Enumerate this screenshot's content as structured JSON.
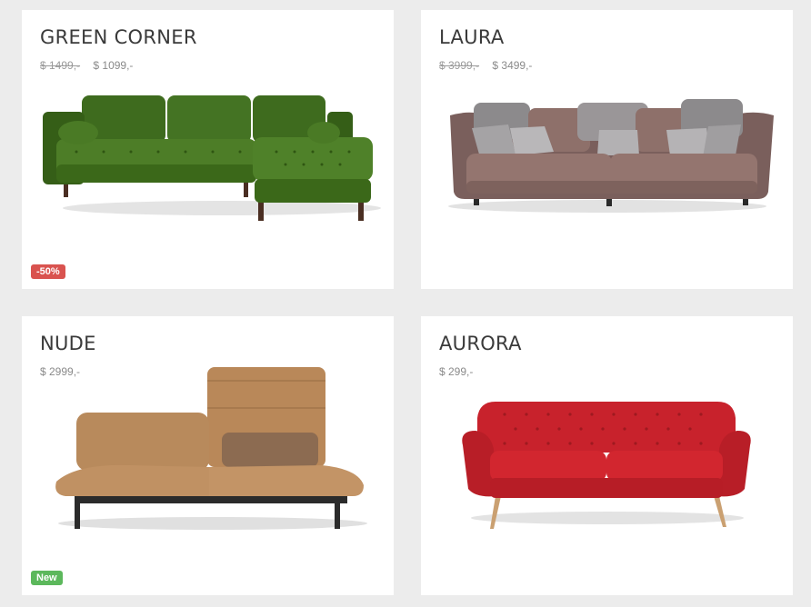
{
  "products": [
    {
      "name": "GREEN CORNER",
      "price_old": "$ 1499,-",
      "price": "$ 1099,-",
      "badge": "-50%",
      "image": "green-corner-sofa"
    },
    {
      "name": "LAURA",
      "price_old": "$ 3999,-",
      "price": "$ 3499,-",
      "badge": "",
      "image": "mauve-sofa-with-pillows"
    },
    {
      "name": "NUDE",
      "price_old": "",
      "price": "$ 2999,-",
      "badge": "New",
      "image": "tan-reclining-sofa"
    },
    {
      "name": "AURORA",
      "price_old": "",
      "price": "$ 299,-",
      "badge": "",
      "image": "red-tufted-sofa"
    }
  ],
  "colors": {
    "sale_badge": "#d9534f",
    "new_badge": "#5cb85c",
    "background": "#ececec"
  }
}
